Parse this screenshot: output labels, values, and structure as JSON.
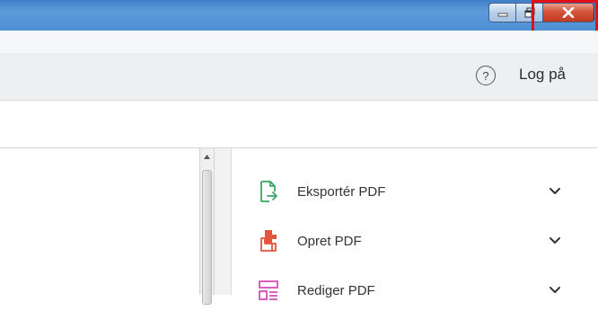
{
  "window": {
    "controls": {
      "minimize_icon": "minimize-icon",
      "restore_icon": "restore-icon",
      "close_icon": "close-icon"
    },
    "highlight_color": "#e0101a"
  },
  "toolbar": {
    "help_symbol": "?",
    "login_label": "Log på"
  },
  "tools": [
    {
      "label": "Eksportér PDF",
      "icon": "export-pdf-icon",
      "color": "#3aa760"
    },
    {
      "label": "Opret PDF",
      "icon": "create-pdf-icon",
      "color": "#e5533d"
    },
    {
      "label": "Rediger PDF",
      "icon": "edit-pdf-icon",
      "color": "#d54fb8"
    }
  ]
}
